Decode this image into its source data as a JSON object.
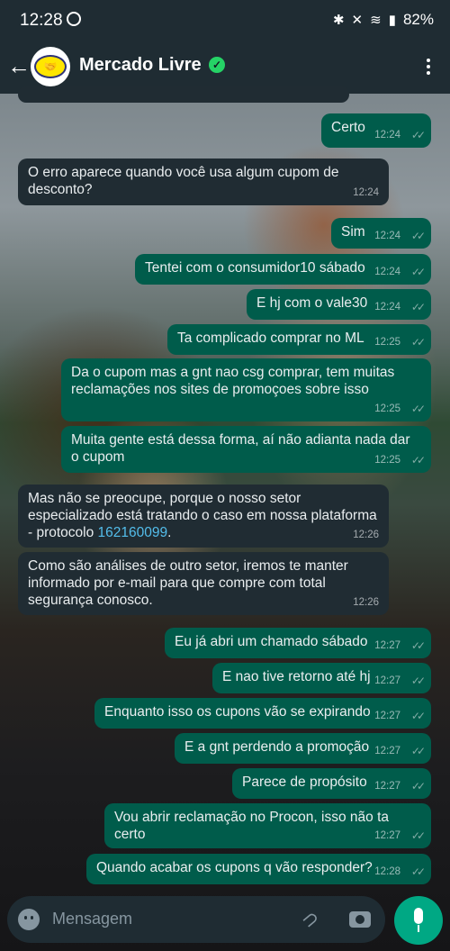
{
  "status": {
    "time": "12:28",
    "battery": "82%"
  },
  "header": {
    "title": "Mercado Livre",
    "back_icon": "arrow-left-icon",
    "verified_icon": "verified-check-icon",
    "menu_icon": "more-vert-icon"
  },
  "messages": [
    {
      "dir": "out",
      "text": "Certo",
      "time": "12:24"
    },
    {
      "dir": "in",
      "text": "O erro aparece quando você usa algum cupom de desconto?",
      "time": "12:24"
    },
    {
      "dir": "out",
      "text": "Sim",
      "time": "12:24"
    },
    {
      "dir": "out",
      "text": "Tentei com o consumidor10 sábado",
      "time": "12:24"
    },
    {
      "dir": "out",
      "text": "E hj com o vale30",
      "time": "12:24"
    },
    {
      "dir": "out",
      "text": "Ta complicado comprar no ML",
      "time": "12:25"
    },
    {
      "dir": "out",
      "text": "Da o cupom mas a gnt nao csg comprar, tem muitas reclamações nos sites de promoçoes sobre isso",
      "time": "12:25"
    },
    {
      "dir": "out",
      "text": "Muita gente está dessa forma, aí não adianta nada dar o cupom",
      "time": "12:25"
    },
    {
      "dir": "in",
      "text": "Mas não se preocupe, porque o nosso setor especializado está tratando o caso em nossa plataforma - protocolo ",
      "link": "162160099",
      "suffix": ".",
      "time": "12:26"
    },
    {
      "dir": "in",
      "text": "Como são análises de outro setor, iremos te manter informado por e-mail para que compre com total segurança conosco.",
      "time": "12:26"
    },
    {
      "dir": "out",
      "text": "Eu já abri um chamado sábado",
      "time": "12:27"
    },
    {
      "dir": "out",
      "text": "E nao tive retorno até hj",
      "time": "12:27"
    },
    {
      "dir": "out",
      "text": "Enquanto isso os cupons vão se expirando",
      "time": "12:27"
    },
    {
      "dir": "out",
      "text": "E a gnt perdendo a promoção",
      "time": "12:27"
    },
    {
      "dir": "out",
      "text": "Parece de propósito",
      "time": "12:27"
    },
    {
      "dir": "out",
      "text": "Vou abrir reclamação no Procon, isso não ta certo",
      "time": "12:27"
    },
    {
      "dir": "out",
      "text": "Quando acabar os cupons q vão responder?",
      "time": "12:28"
    }
  ],
  "composer": {
    "placeholder": "Mensagem",
    "emoji_icon": "emoji-icon",
    "attach_icon": "paperclip-icon",
    "camera_icon": "camera-icon",
    "mic_icon": "mic-icon"
  }
}
